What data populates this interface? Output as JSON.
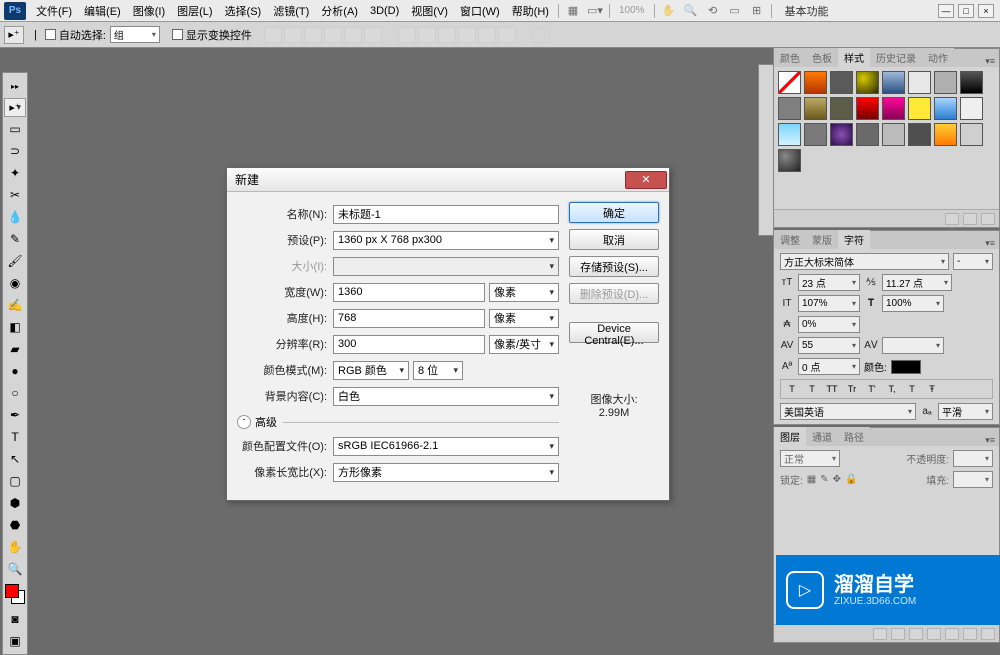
{
  "menubar": {
    "items": [
      "文件(F)",
      "编辑(E)",
      "图像(I)",
      "图层(L)",
      "选择(S)",
      "滤镜(T)",
      "分析(A)",
      "3D(D)",
      "视图(V)",
      "窗口(W)",
      "帮助(H)"
    ],
    "zoom": "100%",
    "workspace": "基本功能"
  },
  "optbar": {
    "auto_select": "自动选择:",
    "group": "组",
    "show_transform": "显示变换控件"
  },
  "dialog": {
    "title": "新建",
    "name_label": "名称(N):",
    "name_value": "未标题-1",
    "preset_label": "预设(P):",
    "preset_value": "1360 px X 768 px300",
    "size_label": "大小(I):",
    "size_value": "",
    "width_label": "宽度(W):",
    "width_value": "1360",
    "width_unit": "像素",
    "height_label": "高度(H):",
    "height_value": "768",
    "height_unit": "像素",
    "res_label": "分辨率(R):",
    "res_value": "300",
    "res_unit": "像素/英寸",
    "mode_label": "颜色模式(M):",
    "mode_value": "RGB 颜色",
    "depth_value": "8 位",
    "bg_label": "背景内容(C):",
    "bg_value": "白色",
    "adv_label": "高级",
    "profile_label": "颜色配置文件(O):",
    "profile_value": "sRGB IEC61966-2.1",
    "aspect_label": "像素长宽比(X):",
    "aspect_value": "方形像素",
    "ok": "确定",
    "cancel": "取消",
    "save_preset": "存储预设(S)...",
    "del_preset": "删除预设(D)...",
    "device_central": "Device Central(E)...",
    "size_info_label": "图像大小:",
    "size_info_value": "2.99M"
  },
  "panels": {
    "styles_tabs": [
      "颜色",
      "色板",
      "样式",
      "历史记录",
      "动作"
    ],
    "char_tabs": [
      "调整",
      "蒙版",
      "字符"
    ],
    "layers_tabs": [
      "图层",
      "通道",
      "路径"
    ],
    "font_family": "方正大标宋简体",
    "font_style": "-",
    "font_size": "23 点",
    "leading": "11.27 点",
    "vscale": "107%",
    "hscale": "100%",
    "tracking1": "0%",
    "kerning": "55",
    "baseline": "0 点",
    "color_label": "颜色:",
    "tt_labels": [
      "T",
      "T",
      "TT",
      "Tr",
      "T'",
      "T,",
      "T",
      "Ŧ"
    ],
    "lang": "美国英语",
    "aa_l": "aₐ",
    "aa": "平滑",
    "blend": "正常",
    "opacity_l": "不透明度:",
    "lock_l": "锁定:",
    "fill_l": "填充:"
  },
  "watermark": {
    "title": "溜溜自学",
    "sub": "ZIXUE.3D66.COM"
  },
  "style_swatches": [
    "linear-gradient(135deg,#fff 45%,#f00 45%,#f00 55%,#fff 55%)",
    "linear-gradient(#ff7a00,#b33600)",
    "#5a5a5a",
    "radial-gradient(circle at 30% 30%,#d7c900,#2a2a00)",
    "linear-gradient(#9fb8db,#29527f)",
    "#e8e8e8",
    "#b0b0b0",
    "linear-gradient(#555,#000)",
    "#808080",
    "linear-gradient(#bba963,#6e5a1e)",
    "#5c5c48",
    "linear-gradient(#ff0000,#7a0000)",
    "linear-gradient(#ff069c,#8a0053)",
    "#ffe936",
    "linear-gradient(#a6d6ff,#2a7fd4)",
    "#efefef",
    "linear-gradient(#7ad6ff,#d3f3ff)",
    "#7a7a7a",
    "radial-gradient(circle,#8d4fb2,#2c0f4c)",
    "#6a6a6a",
    "#bcbcbc",
    "#4e4e4e",
    "linear-gradient(#ffce36,#ff7a00)",
    "#cfcfcf",
    "radial-gradient(circle at 30% 30%,#888,#222)"
  ]
}
